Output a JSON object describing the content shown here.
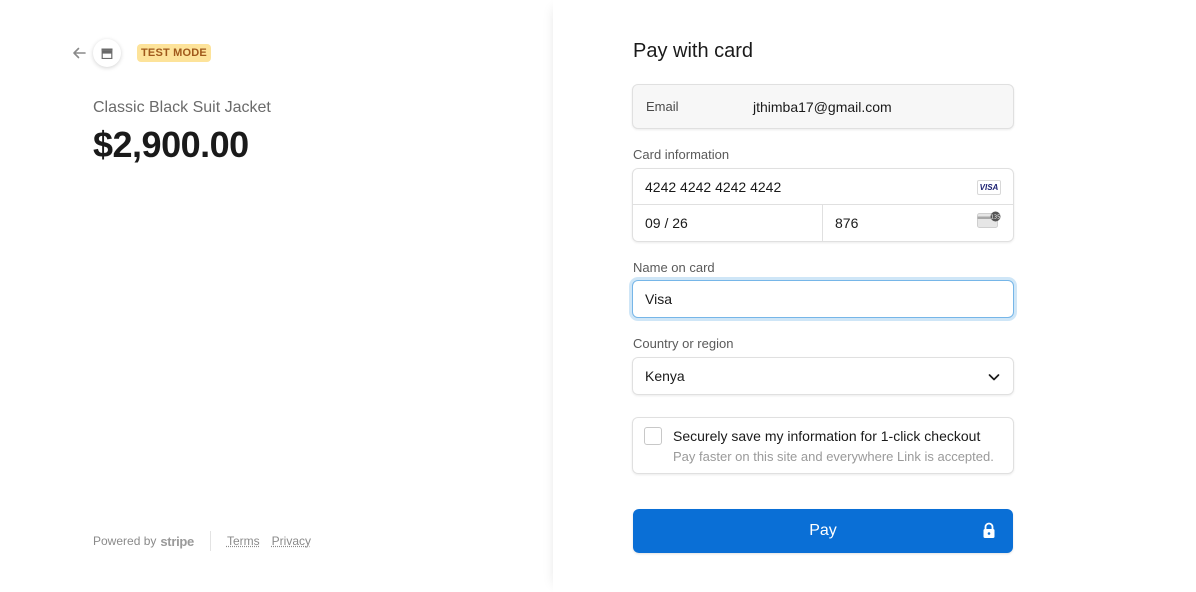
{
  "merchant": {
    "test_mode_label": "TEST MODE"
  },
  "product": {
    "name": "Classic Black Suit Jacket",
    "price": "$2,900.00"
  },
  "footer": {
    "powered_by": "Powered by",
    "brand": "stripe",
    "terms": "Terms",
    "privacy": "Privacy"
  },
  "form": {
    "title": "Pay with card",
    "email": {
      "label": "Email",
      "value": "jthimba17@gmail.com"
    },
    "card": {
      "label": "Card information",
      "number": "4242 4242 4242 4242",
      "brand_icon_text": "VISA",
      "expiry": "09 / 26",
      "cvc": "876"
    },
    "name": {
      "label": "Name on card",
      "value": "Visa"
    },
    "country": {
      "label": "Country or region",
      "value": "Kenya"
    },
    "save": {
      "title": "Securely save my information for 1-click checkout",
      "subtitle": "Pay faster on this site and everywhere Link is accepted.",
      "checked": false
    },
    "pay_button": "Pay"
  },
  "colors": {
    "accent": "#0a6fd6",
    "test_badge_bg": "#fde39a",
    "test_badge_text": "#a0591b",
    "focus_ring": "#76b6e8"
  },
  "icons": {
    "back": "arrow-left-icon",
    "store": "store-icon",
    "card_brand": "visa-icon",
    "cvc": "card-cvc-icon",
    "dropdown": "chevron-down-icon",
    "lock": "lock-icon"
  }
}
